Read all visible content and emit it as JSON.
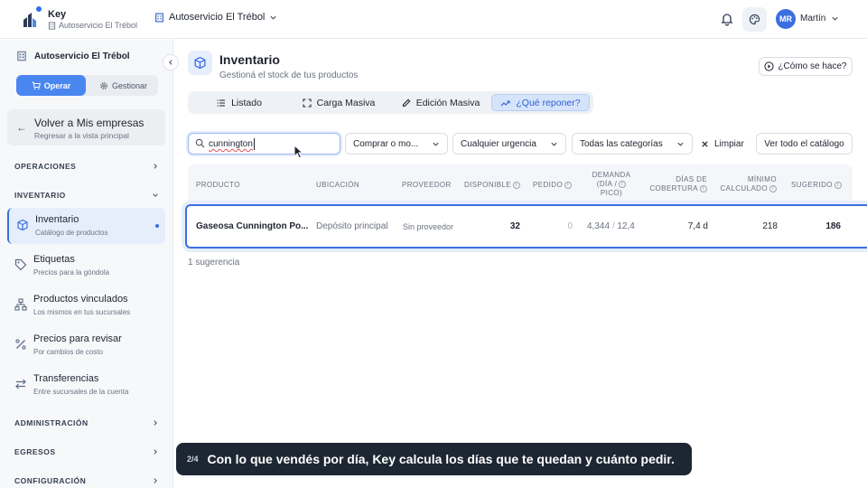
{
  "app": {
    "name": "Key",
    "subtitle": "Autoservicio El Trébol"
  },
  "header": {
    "store": "Autoservicio El Trébol",
    "user_initials": "MR",
    "user_name": "Martín"
  },
  "sidebar": {
    "store": "Autoservicio El Trébol",
    "toggle": {
      "operate": "Operar",
      "manage": "Gestionar"
    },
    "back": {
      "title": "Volver a Mis empresas",
      "subtitle": "Regresar a la vista principal"
    },
    "sections": {
      "operations": "OPERACIONES",
      "inventory": "INVENTARIO",
      "admin": "ADMINISTRACIÓN",
      "expenses": "EGRESOS",
      "config": "CONFIGURACIÓN"
    },
    "items": [
      {
        "title": "Inventario",
        "subtitle": "Catálogo de productos"
      },
      {
        "title": "Etiquetas",
        "subtitle": "Precios para la góndola"
      },
      {
        "title": "Productos vinculados",
        "subtitle": "Los mismos en tus sucursales"
      },
      {
        "title": "Precios para revisar",
        "subtitle": "Por cambios de costo"
      },
      {
        "title": "Transferencias",
        "subtitle": "Entre sucursales de la cuenta"
      }
    ]
  },
  "main": {
    "title": "Inventario",
    "subtitle": "Gestioná el stock de tus productos",
    "how_button": "¿Cómo se hace?",
    "tabs": [
      "Listado",
      "Carga Masiva",
      "Edición Masiva",
      "¿Qué reponer?"
    ],
    "active_tab": 3,
    "search_value": "cunnington",
    "filters": [
      "Comprar o mo...",
      "Cualquier urgencia",
      "Todas las categorías"
    ],
    "clear": "Limpiar",
    "catalog_button": "Ver todo el catálogo",
    "columns": [
      "PRODUCTO",
      "UBICACIÓN",
      "PROVEEDOR",
      "DISPONIBLE",
      "PEDIDO",
      "DEMANDA",
      "(DÍA /",
      "PICO)",
      "DÍAS DE",
      "COBERTURA",
      "MÍNIMO",
      "CALCULADO",
      "SUGERIDO"
    ],
    "row": {
      "product": "Gaseosa Cunnington Po...",
      "location": "Depósito principal",
      "supplier": "Sin proveedor",
      "available": "32",
      "ordered": "0",
      "demand_day": "4,344",
      "demand_sep": "/",
      "demand_peak": "12,4",
      "coverage": "7,4 d",
      "minimum": "218",
      "suggested": "186"
    },
    "result_count": "1 sugerencia"
  },
  "caption": {
    "step": "2/4",
    "text": "Con lo que vendés por día, Key calcula los días que te quedan y cuánto pedir."
  },
  "colors": {
    "accent": "#3b6fe0",
    "caption_bg": "#1d2733"
  }
}
